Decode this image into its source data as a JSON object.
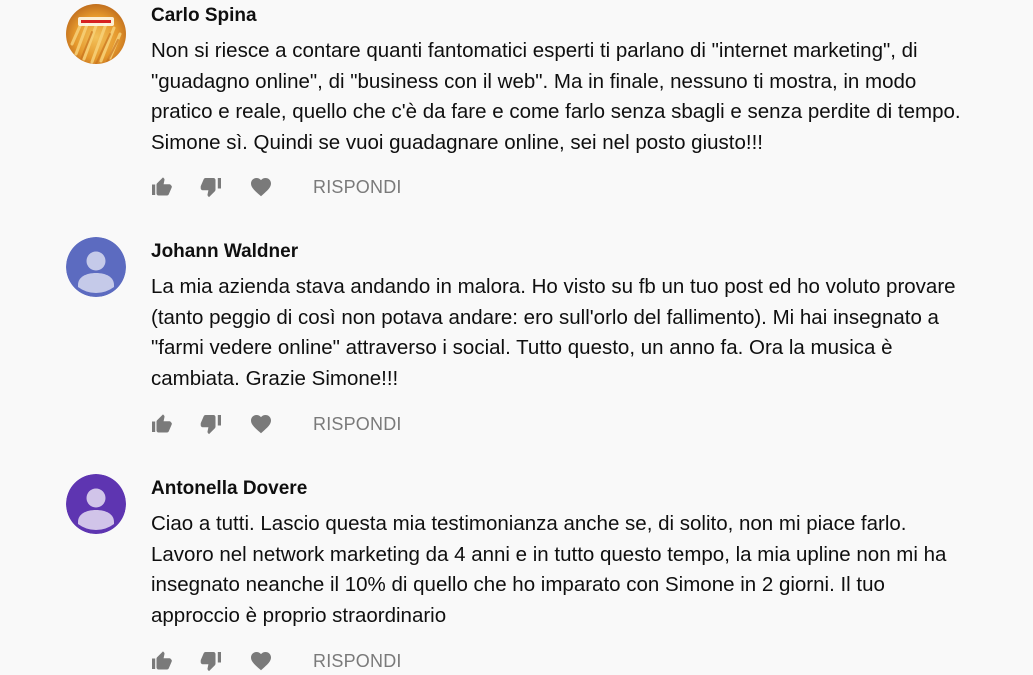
{
  "colors": {
    "background": "#f9f9f9",
    "text": "#0f0f0f",
    "icon": "#7a7a7a",
    "avatar_blue": "#5c6bc0",
    "avatar_purple": "#5e35b1",
    "avatar_person": "#c5cae9"
  },
  "comments": [
    {
      "author": "Carlo Spina",
      "avatar": "photo-avatar",
      "lines": [
        "Non si riesce a contare quanti fantomatici esperti ti parlano di \"internet marketing\", di",
        "\"guadagno online\", di \"business con il web\". Ma in finale, nessuno ti mostra, in modo",
        "pratico e reale, quello che c'è da fare e come farlo senza sbagli e senza perdite di tempo.",
        "Simone sì. Quindi se vuoi guadagnare online, sei nel posto giusto!!!"
      ],
      "reply_label": "RISPONDI"
    },
    {
      "author": "Johann Waldner",
      "avatar": "default-avatar",
      "lines": [
        "La mia azienda stava andando in malora. Ho visto su fb un tuo post ed ho voluto provare",
        "(tanto peggio di così non potava andare: ero sull'orlo del fallimento). Mi hai insegnato a",
        "\"farmi vedere online\" attraverso i social. Tutto questo, un anno fa. Ora la musica è",
        "cambiata. Grazie Simone!!!"
      ],
      "reply_label": "RISPONDI"
    },
    {
      "author": "Antonella Dovere",
      "avatar": "default-avatar",
      "lines": [
        "Ciao a tutti. Lascio questa mia testimonianza anche se, di solito, non mi piace farlo.",
        "Lavoro nel network marketing da 4 anni e in tutto questo tempo, la mia upline non mi ha",
        "insegnato neanche il 10% di quello che ho imparato con Simone in 2 giorni. Il tuo",
        "approccio è proprio straordinario"
      ],
      "reply_label": "RISPONDI"
    }
  ]
}
